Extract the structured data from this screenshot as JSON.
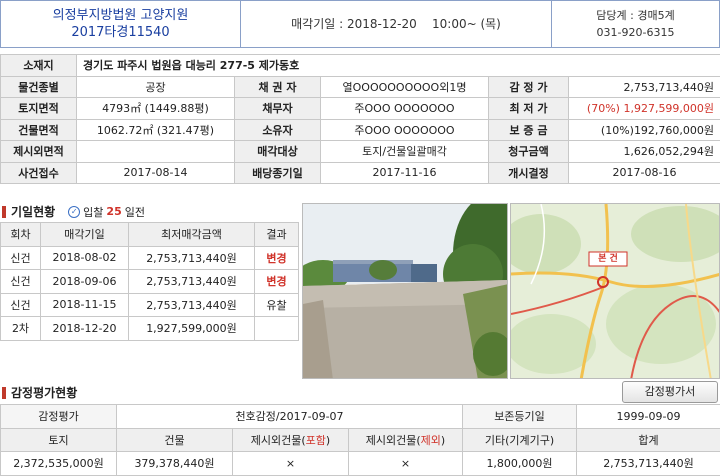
{
  "header": {
    "court": "의정부지방법원 고양지원",
    "case_no": "2017타경11540",
    "sale_date_label": "매각기일",
    "sale_date": "2018-12-20",
    "sale_time": "10:00~ (목)",
    "dept": "담당계 : 경매5계",
    "phone": "031-920-6315"
  },
  "info": {
    "address_label": "소재지",
    "address": "경기도 파주시 법원읍 대능리 277-5 제가동호",
    "use_type_label": "물건종별",
    "use_type": "공장",
    "creditor_label": "채 권 자",
    "creditor": "열OOOOOOOOOO외1명",
    "appraisal_label": "감 정 가",
    "appraisal": "2,753,713,440원",
    "land_area_label": "토지면적",
    "land_area": "4793㎡ (1449.88평)",
    "debtor_label": "채무자",
    "debtor": "주OOO OOOOOOO",
    "min_price_label": "최 저 가",
    "min_price": "(70%) 1,927,599,000원",
    "bldg_area_label": "건물면적",
    "bldg_area": "1062.72㎡ (321.47평)",
    "owner_label": "소유자",
    "owner": "주OOO OOOOOOO",
    "deposit_label": "보 증 금",
    "deposit": "(10%)192,760,000원",
    "excluded_label": "제시외면적",
    "excluded": "",
    "sale_target_label": "매각대상",
    "sale_target": "토지/건물일괄매각",
    "claim_label": "청구금액",
    "claim": "1,626,052,294원",
    "case_received_label": "사건접수",
    "case_received": "2017-08-14",
    "dividend_label": "배당종기일",
    "dividend": "2017-11-16",
    "commence_label": "개시결정",
    "commence": "2017-08-16"
  },
  "history": {
    "title": "기일현황",
    "check_label": "입찰",
    "days": "25",
    "days_suffix": "일전",
    "headers": [
      "회차",
      "매각기일",
      "최저매각금액",
      "결과"
    ],
    "rows": [
      {
        "round": "신건",
        "date": "2018-08-02",
        "price": "2,753,713,440원",
        "result": "변경"
      },
      {
        "round": "신건",
        "date": "2018-09-06",
        "price": "2,753,713,440원",
        "result": "변경"
      },
      {
        "round": "신건",
        "date": "2018-11-15",
        "price": "2,753,713,440원",
        "result": "유찰"
      },
      {
        "round": "2차",
        "date": "2018-12-20",
        "price": "1,927,599,000원",
        "result": ""
      }
    ]
  },
  "map": {
    "marker_label": "본 건"
  },
  "appraisal": {
    "title": "감정평가현황",
    "button": "감정평가서",
    "label": "감정평가",
    "agency": "천호감정/2017-09-07",
    "preserve_label": "보존등기일",
    "preserve_date": "1999-09-09",
    "headers": [
      "토지",
      "건물",
      "제시외건물(",
      "포함",
      ")",
      "제시외건물(",
      "제외",
      ")",
      "기타(기계기구)",
      "합계"
    ],
    "values": [
      "2,372,535,000원",
      "379,378,440원",
      "×",
      "×",
      "1,800,000원",
      "2,753,713,440원"
    ]
  },
  "colors": {
    "accent": "#1a3fa0",
    "highlight": "#d0332a",
    "label_bg": "#efefef"
  }
}
